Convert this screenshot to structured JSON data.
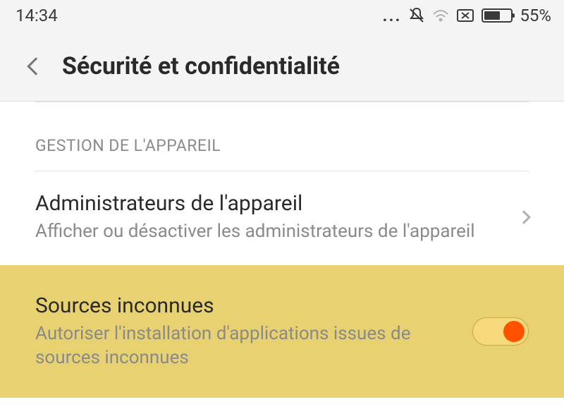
{
  "statusBar": {
    "time": "14:34",
    "batteryPercent": "55%"
  },
  "header": {
    "title": "Sécurité et confidentialité"
  },
  "section": {
    "label": "GESTION DE L'APPAREIL"
  },
  "adminItem": {
    "title": "Administrateurs de l'appareil",
    "subtitle": "Afficher ou désactiver les administrateurs de l'appareil"
  },
  "unknownSources": {
    "title": "Sources inconnues",
    "subtitle": "Autoriser l'installation d'applications issues de sources inconnues",
    "enabled": true
  }
}
